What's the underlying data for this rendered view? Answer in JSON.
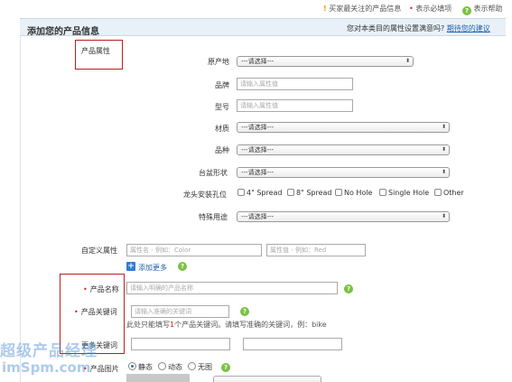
{
  "topbar": {
    "fav_label": "买家最关注的产品信息",
    "required_label": "表示必填项",
    "help_label": "表示帮助"
  },
  "header": {
    "title": "添加您的产品信息",
    "question": "您对本类目的属性设置满意吗?",
    "feedback_link": "期待您的建议"
  },
  "attributes": {
    "section_label": "产品属性",
    "origin_label": "原产地",
    "origin_value": "---请选择---",
    "brand_label": "品牌",
    "brand_placeholder": "请输入属性值",
    "model_label": "型号",
    "model_placeholder": "请输入属性值",
    "material_label": "材质",
    "material_value": "---请选择---",
    "variety_label": "品种",
    "variety_value": "---请选择---",
    "basin_label": "台盆形状",
    "basin_value": "---请选择---",
    "faucet_label": "龙头安装孔位",
    "faucet_options": [
      "4\" Spread",
      "8\" Spread",
      "No Hole",
      "Single Hole",
      "Other"
    ],
    "special_label": "特殊用途",
    "special_value": "---请选择---"
  },
  "custom": {
    "label": "自定义属性",
    "name_placeholder": "属性名 - 例如：Color",
    "value_placeholder": "属性值 - 例如：Red",
    "add_more": "添加更多"
  },
  "product_name": {
    "label": "产品名称",
    "placeholder": "请输入明确的产品名称"
  },
  "keyword": {
    "label": "产品关键词",
    "placeholder": "请输入准确的关键词",
    "hint_prefix": "此处只能填写",
    "hint_num": "1",
    "hint_suffix": "个产品关键词。请填写准确的关键词，例：bike"
  },
  "more_keywords": {
    "label": "更多关键词"
  },
  "product_image": {
    "label": "产品图片",
    "options": [
      "静态",
      "动态",
      "无图"
    ],
    "selected": "静态"
  },
  "watermark": {
    "line1": "超级产品经理",
    "line2": "imSpm.com"
  },
  "colors": {
    "required": "#d21f1f",
    "link": "#1f5fa8",
    "help": "#7ac142",
    "highlight_box": "#b81f1f",
    "header_bg": "#e9f1f8"
  }
}
